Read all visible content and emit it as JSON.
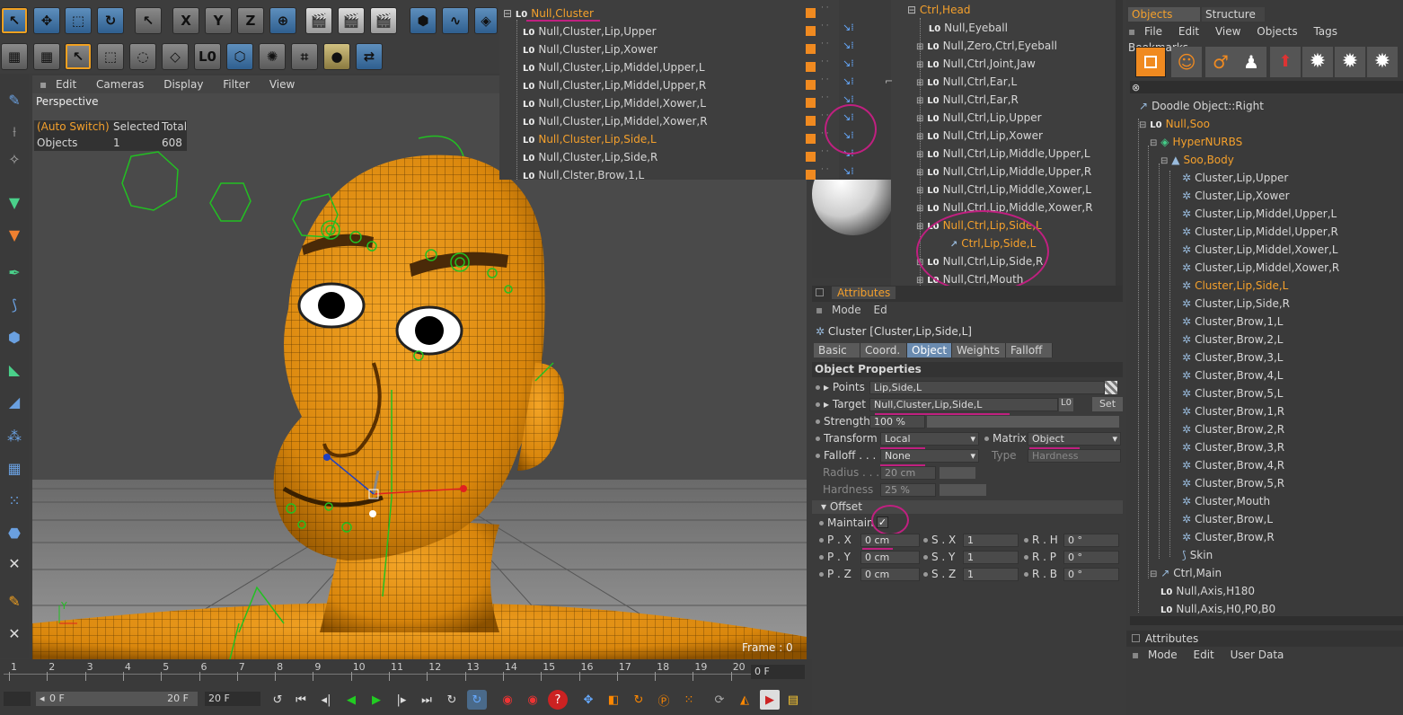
{
  "viewport": {
    "menu": [
      "Edit",
      "Cameras",
      "Display",
      "Filter",
      "View"
    ],
    "name": "Perspective",
    "hud": {
      "col1": "(Auto Switch)",
      "col2": "Selected",
      "col3": "Total",
      "row_label": "Objects",
      "selected": "1",
      "total": "608"
    },
    "frame": "Frame : 0",
    "axis_y": "Y"
  },
  "top_toolbar": {
    "x_label": "X",
    "y_label": "Y",
    "z_label": "Z",
    "l0_label": "L0"
  },
  "cluster_list": {
    "header": "Null,Cluster",
    "items": [
      "Null,Cluster,Lip,Upper",
      "Null,Cluster,Lip,Xower",
      "Null,Cluster,Lip,Middel,Upper,L",
      "Null,Cluster,Lip,Middel,Upper,R",
      "Null,Cluster,Lip,Middel,Xower,L",
      "Null,Cluster,Lip,Middel,Xower,R",
      "Null,Cluster,Lip,Side,L",
      "Null,Cluster,Lip,Side,R",
      "Null,Clster,Brow,1,L"
    ]
  },
  "ctrl_list": {
    "header": "Ctrl,Head",
    "items": [
      "Null,Eyeball",
      "Null,Zero,Ctrl,Eyeball",
      "Null,Ctrl,Joint,Jaw",
      "Null,Ctrl,Ear,L",
      "Null,Ctrl,Ear,R",
      "Null,Ctrl,Lip,Upper",
      "Null,Ctrl,Lip,Xower",
      "Null,Ctrl,Lip,Middle,Upper,L",
      "Null,Ctrl,Lip,Middle,Upper,R",
      "Null,Ctrl,Lip,Middle,Xower,L",
      "Null,Ctrl,Lip,Middle,Xower,R",
      "Null,Ctrl,Lip,Side,L",
      "Ctrl,Lip,Side,L",
      "Null,Ctrl,Lip,Side,R",
      "Null,Ctrl,Mouth",
      "Null,Ctrl,Brow,L",
      "Null,Ctrl,Brow,R"
    ]
  },
  "attributes": {
    "title": "Attributes",
    "menu_mode": "Mode",
    "menu_edit": "Ed",
    "object_title": "Cluster [Cluster,Lip,Side,L]",
    "tabs": [
      "Basic",
      "Coord.",
      "Object",
      "Weights",
      "Falloff"
    ],
    "section": "Object Properties",
    "points_label": "Points",
    "points_value": "Lip,Side,L",
    "target_label": "Target",
    "target_value": "Null,Cluster,Lip,Side,L",
    "set_label": "Set",
    "strength_label": "Strength",
    "strength_value": "100 %",
    "transform_label": "Transform",
    "transform_value": "Local",
    "matrix_label": "Matrix",
    "matrix_value": "Object",
    "falloff_label": "Falloff . . . .",
    "falloff_value": "None",
    "type_label": "Type",
    "type_value": "Hardness",
    "radius_label": "Radius . . .",
    "radius_value": "20 cm",
    "hardness_label": "Hardness",
    "hardness_value": "25 %",
    "offset_label": "Offset",
    "maintain_label": "Maintain",
    "px_label": "P . X",
    "px_value": "0 cm",
    "py_label": "P . Y",
    "py_value": "0 cm",
    "pz_label": "P . Z",
    "pz_value": "0 cm",
    "sx_label": "S . X",
    "sx_value": "1",
    "sy_label": "S . Y",
    "sy_value": "1",
    "sz_label": "S . Z",
    "sz_value": "1",
    "rh_label": "R . H",
    "rh_value": "0 °",
    "rp_label": "R . P",
    "rp_value": "0 °",
    "rb_label": "R . B",
    "rb_value": "0 °"
  },
  "objects_panel": {
    "tabs": [
      "Objects",
      "Structure"
    ],
    "menu": [
      "File",
      "Edit",
      "View",
      "Objects",
      "Tags",
      "Bookmarks"
    ],
    "tree": [
      {
        "label": "Doodle Object::Right",
        "indent": 0,
        "orange": false
      },
      {
        "label": "Null,Soo",
        "indent": 0,
        "orange": true
      },
      {
        "label": "HyperNURBS",
        "indent": 1,
        "orange": true
      },
      {
        "label": "Soo,Body",
        "indent": 2,
        "orange": true
      },
      {
        "label": "Cluster,Lip,Upper",
        "indent": 3,
        "orange": false
      },
      {
        "label": "Cluster,Lip,Xower",
        "indent": 3,
        "orange": false
      },
      {
        "label": "Cluster,Lip,Middel,Upper,L",
        "indent": 3,
        "orange": false
      },
      {
        "label": "Cluster,Lip,Middel,Upper,R",
        "indent": 3,
        "orange": false
      },
      {
        "label": "Cluster,Lip,Middel,Xower,L",
        "indent": 3,
        "orange": false
      },
      {
        "label": "Cluster,Lip,Middel,Xower,R",
        "indent": 3,
        "orange": false
      },
      {
        "label": "Cluster,Lip,Side,L",
        "indent": 3,
        "orange": true
      },
      {
        "label": "Cluster,Lip,Side,R",
        "indent": 3,
        "orange": false
      },
      {
        "label": "Cluster,Brow,1,L",
        "indent": 3,
        "orange": false
      },
      {
        "label": "Cluster,Brow,2,L",
        "indent": 3,
        "orange": false
      },
      {
        "label": "Cluster,Brow,3,L",
        "indent": 3,
        "orange": false
      },
      {
        "label": "Cluster,Brow,4,L",
        "indent": 3,
        "orange": false
      },
      {
        "label": "Cluster,Brow,5,L",
        "indent": 3,
        "orange": false
      },
      {
        "label": "Cluster,Brow,1,R",
        "indent": 3,
        "orange": false
      },
      {
        "label": "Cluster,Brow,2,R",
        "indent": 3,
        "orange": false
      },
      {
        "label": "Cluster,Brow,3,R",
        "indent": 3,
        "orange": false
      },
      {
        "label": "Cluster,Brow,4,R",
        "indent": 3,
        "orange": false
      },
      {
        "label": "Cluster,Brow,5,R",
        "indent": 3,
        "orange": false
      },
      {
        "label": "Cluster,Mouth",
        "indent": 3,
        "orange": false
      },
      {
        "label": "Cluster,Brow,L",
        "indent": 3,
        "orange": false
      },
      {
        "label": "Cluster,Brow,R",
        "indent": 3,
        "orange": false
      },
      {
        "label": "Skin",
        "indent": 3,
        "orange": false
      },
      {
        "label": "Ctrl,Main",
        "indent": 1,
        "orange": false
      },
      {
        "label": "Null,Axis,H180",
        "indent": 2,
        "orange": false
      },
      {
        "label": "Null,Axis,H0,P0,B0",
        "indent": 2,
        "orange": false
      }
    ],
    "attr_title": "Attributes",
    "attr_menu": [
      "Mode",
      "Edit",
      "User Data"
    ]
  },
  "timeline": {
    "ticks": [
      "1",
      "2",
      "3",
      "4",
      "5",
      "6",
      "7",
      "8",
      "9",
      "10",
      "11",
      "12",
      "13",
      "14",
      "15",
      "16",
      "17",
      "18",
      "19",
      "20"
    ],
    "current": "0 F",
    "start": "0 F",
    "end": "20 F",
    "max": "20 F"
  },
  "colors": {
    "accent": "#f4a02c",
    "highlight": "#c02080",
    "bg": "#3b3b3b"
  }
}
